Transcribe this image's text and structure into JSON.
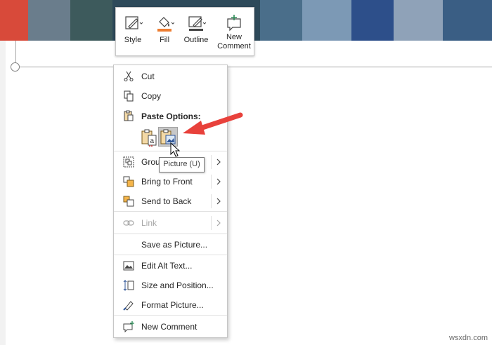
{
  "toolbar": {
    "style_label": "Style",
    "fill_label": "Fill",
    "outline_label": "Outline",
    "new_comment_label_line1": "New",
    "new_comment_label_line2": "Comment",
    "fill_accent": "#ed7d31"
  },
  "menu": {
    "cut": "Cut",
    "copy": "Copy",
    "paste_options_header": "Paste Options:",
    "group": "Group",
    "bring_to_front": "Bring to Front",
    "send_to_back": "Send to Back",
    "link": "Link",
    "save_as_picture": "Save as Picture...",
    "edit_alt_text": "Edit Alt Text...",
    "size_and_position": "Size and Position...",
    "format_picture": "Format Picture...",
    "new_comment": "New Comment"
  },
  "paste_options": {
    "keep_text_only_icon": "paste-keep-text-icon",
    "picture_icon": "paste-picture-icon",
    "picture_tooltip": "Picture (U)"
  },
  "annotation": {
    "arrow_color": "#e8413b"
  },
  "watermark": "wsxdn.com"
}
